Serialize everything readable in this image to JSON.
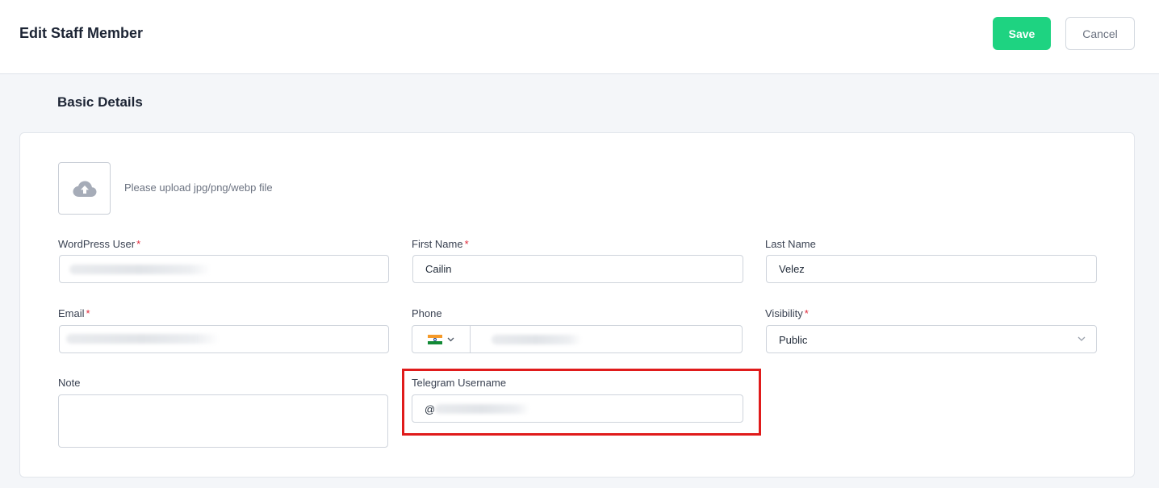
{
  "header": {
    "title": "Edit Staff Member",
    "save_label": "Save",
    "cancel_label": "Cancel"
  },
  "section": {
    "title": "Basic Details"
  },
  "upload": {
    "hint": "Please upload jpg/png/webp file",
    "icon": "cloud-upload-icon"
  },
  "form": {
    "wordpress_user": {
      "label": "WordPress User",
      "required": "*",
      "value": ""
    },
    "first_name": {
      "label": "First Name",
      "required": "*",
      "value": "Cailin"
    },
    "last_name": {
      "label": "Last Name",
      "value": "Velez"
    },
    "email": {
      "label": "Email",
      "required": "*",
      "value": ""
    },
    "phone": {
      "label": "Phone",
      "country_flag": "india-flag-icon",
      "value": ""
    },
    "visibility": {
      "label": "Visibility",
      "required": "*",
      "value": "Public"
    },
    "note": {
      "label": "Note",
      "value": ""
    },
    "telegram": {
      "label": "Telegram Username",
      "prefix": "@",
      "value": ""
    }
  },
  "colors": {
    "save_button": "#1ed381",
    "required_asterisk": "#e0293a",
    "highlight_border": "#e01b1b"
  }
}
